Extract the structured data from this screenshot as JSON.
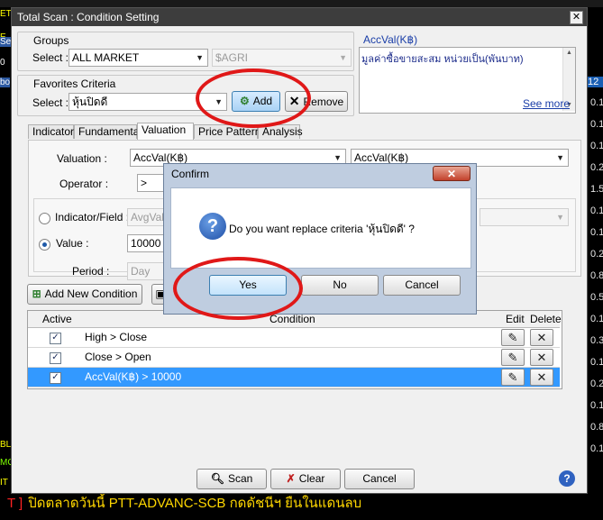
{
  "background": {
    "left_labels": [
      "ET",
      "E",
      "Se",
      "0",
      "bo",
      "BL",
      "MG",
      "IT"
    ],
    "right_values": [
      "12",
      "0.1",
      "0.1",
      "0.1",
      "0.2",
      "1.5",
      "0.1",
      "0.1",
      "0.2",
      "0.8",
      "0.5",
      "0.1",
      "0.3",
      "0.1",
      "0.2",
      "0.1",
      "0.8",
      "0.1"
    ],
    "ticker_prefix": "T ]",
    "ticker_text": "ปิดตลาดวันนี้ PTT-ADVANC-SCB กดดัชนีฯ ยืนในแดนลบ"
  },
  "window": {
    "title": "Total Scan : Condition Setting",
    "close": "✕"
  },
  "groups": {
    "label": "Groups",
    "select_label": "Select :",
    "market_value": "ALL MARKET",
    "sector_value": "$AGRI"
  },
  "favorites": {
    "label": "Favorites Criteria",
    "select_label": "Select :",
    "value": "หุ้นปิดดี",
    "add_label": "Add",
    "remove_label": "Remove"
  },
  "info": {
    "title": "AccVal(K฿)",
    "description": "มูลค่าซื้อขายสะสม หน่วยเป็น(พันบาท)",
    "see_more": "See more"
  },
  "tabs": [
    "Indicator",
    "Fundamental",
    "Valuation",
    "Price Pattern",
    "Analysis"
  ],
  "active_tab": "Valuation",
  "valuation": {
    "valuation_label": "Valuation :",
    "valuation_value": "AccVal(K฿)",
    "valuation_value2": "AccVal(K฿)",
    "operator_label": "Operator :",
    "operator_value": ">",
    "indicator_field_label": "Indicator/Field :",
    "indicator_field_value": "AvgVal",
    "value_label": "Value :",
    "value_input": "10000",
    "period_label": "Period :",
    "period_value": "Day"
  },
  "add_condition_label": "Add New Condition",
  "grid": {
    "headers": {
      "active": "Active",
      "condition": "Condition",
      "edit": "Edit",
      "delete": "Delete"
    },
    "rows": [
      {
        "condition": "High > Close",
        "checked": "✓"
      },
      {
        "condition": "Close > Open",
        "checked": "✓"
      },
      {
        "condition": "AccVal(K฿) > 10000",
        "checked": "✓"
      }
    ]
  },
  "footer": {
    "scan": "Scan",
    "clear": "Clear",
    "cancel": "Cancel",
    "help": "?"
  },
  "confirm": {
    "title": "Confirm",
    "close": "✕",
    "message": "Do you want replace criteria 'หุ้นปิดดี' ?",
    "yes": "Yes",
    "no": "No",
    "cancel": "Cancel",
    "icon": "?"
  },
  "colors": {
    "selected_row": "#3399ff",
    "annotation_red": "#e01818",
    "dialog_frame": "#bfcde0"
  }
}
